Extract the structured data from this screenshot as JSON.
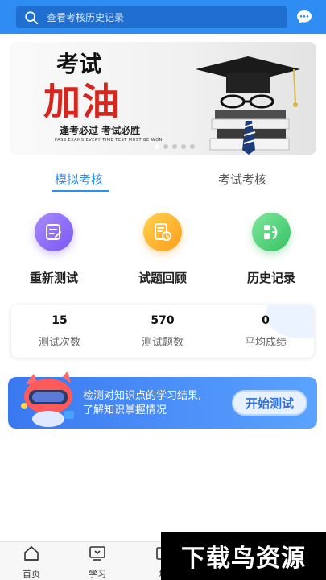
{
  "header": {
    "search_placeholder": "查看考核历史记录",
    "search_icon": "search-icon",
    "message_icon": "chat-bubble-icon"
  },
  "banner": {
    "line1": "考试",
    "line2": "加油",
    "line3": "逢考必过 考试必胜",
    "line4": "PASS EXAMS EVERY TIME TEST MUST BE WON",
    "slide_count": 5,
    "active_slide": 1
  },
  "tabs": [
    {
      "label": "模拟考核",
      "active": true
    },
    {
      "label": "考试考核",
      "active": false
    }
  ],
  "actions": [
    {
      "label": "重新测试",
      "icon": "document-edit-icon"
    },
    {
      "label": "试题回顾",
      "icon": "document-clock-icon"
    },
    {
      "label": "历史记录",
      "icon": "history-list-icon"
    }
  ],
  "stats": [
    {
      "value": "15",
      "label": "测试次数"
    },
    {
      "value": "570",
      "label": "测试题数"
    },
    {
      "value": "0",
      "label": "平均成绩"
    }
  ],
  "promo": {
    "line1": "检测对知识点的学习结果,",
    "line2": "了解知识掌握情况",
    "button": "开始测试"
  },
  "bottom_nav": [
    {
      "label": "首页",
      "icon": "home-icon"
    },
    {
      "label": "学习",
      "icon": "study-icon"
    },
    {
      "label": "培",
      "icon": "training-icon"
    }
  ],
  "watermark": "下载鸟资源",
  "colors": {
    "primary": "#2f8cf2",
    "header_search_bg": "#1f6fd1",
    "banner_red": "#d7261d"
  }
}
